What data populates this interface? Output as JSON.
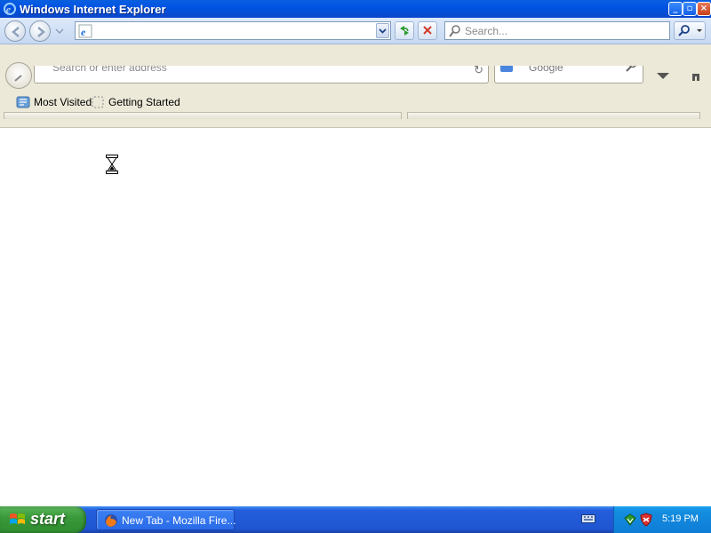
{
  "window": {
    "title": "Windows Internet Explorer"
  },
  "ie_toolbar": {
    "address_value": "",
    "search_placeholder": "Search..."
  },
  "firefox": {
    "address_placeholder": "Search or enter address",
    "search_engine": "Google",
    "bookmarks": [
      {
        "label": "Most Visited",
        "icon": "most-visited-icon"
      },
      {
        "label": "Getting Started",
        "icon": "getting-started-icon"
      }
    ]
  },
  "taskbar": {
    "start_label": "start",
    "tasks": [
      {
        "label": "New Tab - Mozilla Fire...",
        "icon": "firefox-icon"
      }
    ],
    "clock": "5:19 PM"
  },
  "colors": {
    "titlebar": "#0054e3",
    "taskbar": "#245edb",
    "start": "#3a9a3a",
    "tray": "#138de0"
  }
}
